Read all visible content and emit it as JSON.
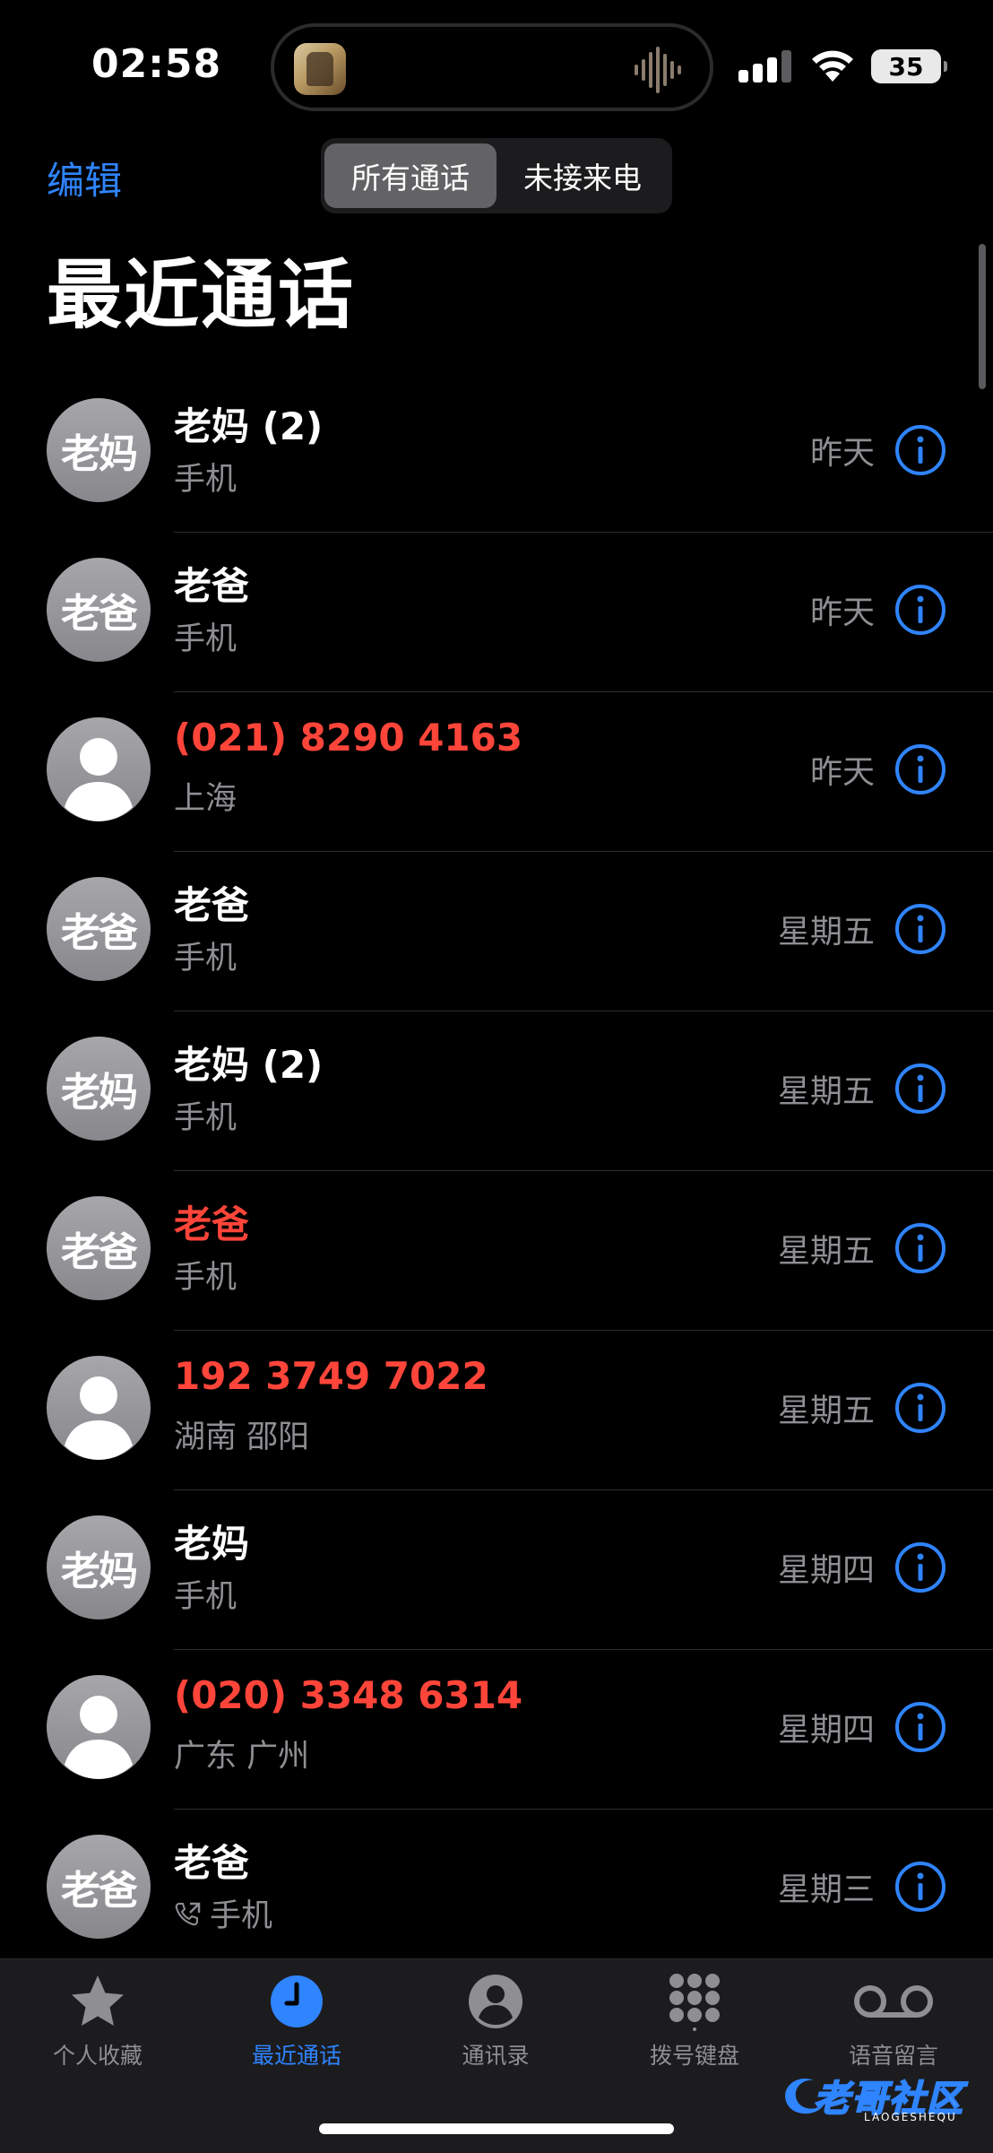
{
  "status_bar": {
    "time": "02:58",
    "battery": "35"
  },
  "nav": {
    "edit_label": "编辑",
    "segments": [
      "所有通话",
      "未接来电"
    ],
    "title": "最近通话"
  },
  "calls": [
    {
      "avatar_text": "老妈",
      "avatar_type": "initials",
      "name": "老妈 (2)",
      "missed": false,
      "subtitle": "手机",
      "outgoing": false,
      "date": "昨天"
    },
    {
      "avatar_text": "老爸",
      "avatar_type": "initials",
      "name": "老爸",
      "missed": false,
      "subtitle": "手机",
      "outgoing": false,
      "date": "昨天"
    },
    {
      "avatar_text": "",
      "avatar_type": "person",
      "name": "(021) 8290 4163",
      "missed": true,
      "subtitle": "上海",
      "outgoing": false,
      "date": "昨天"
    },
    {
      "avatar_text": "老爸",
      "avatar_type": "initials",
      "name": "老爸",
      "missed": false,
      "subtitle": "手机",
      "outgoing": false,
      "date": "星期五"
    },
    {
      "avatar_text": "老妈",
      "avatar_type": "initials",
      "name": "老妈 (2)",
      "missed": false,
      "subtitle": "手机",
      "outgoing": false,
      "date": "星期五"
    },
    {
      "avatar_text": "老爸",
      "avatar_type": "initials",
      "name": "老爸",
      "missed": true,
      "subtitle": "手机",
      "outgoing": false,
      "date": "星期五"
    },
    {
      "avatar_text": "",
      "avatar_type": "person",
      "name": "192 3749 7022",
      "missed": true,
      "subtitle": "湖南 邵阳",
      "outgoing": false,
      "date": "星期五"
    },
    {
      "avatar_text": "老妈",
      "avatar_type": "initials",
      "name": "老妈",
      "missed": false,
      "subtitle": "手机",
      "outgoing": false,
      "date": "星期四"
    },
    {
      "avatar_text": "",
      "avatar_type": "person",
      "name": "(020) 3348 6314",
      "missed": true,
      "subtitle": "广东 广州",
      "outgoing": false,
      "date": "星期四"
    },
    {
      "avatar_text": "老爸",
      "avatar_type": "initials",
      "name": "老爸",
      "missed": false,
      "subtitle": "手机",
      "outgoing": true,
      "date": "星期三"
    }
  ],
  "tabs": [
    {
      "label": "个人收藏",
      "icon": "star-icon",
      "active": false
    },
    {
      "label": "最近通话",
      "icon": "clock-icon",
      "active": true
    },
    {
      "label": "通讯录",
      "icon": "contact-icon",
      "active": false
    },
    {
      "label": "拨号键盘",
      "icon": "keypad-icon",
      "active": false
    },
    {
      "label": "语音留言",
      "icon": "voicemail-icon",
      "active": false
    }
  ],
  "watermark": {
    "text": "老哥社区",
    "subtext": "LAOGESHEQU"
  },
  "colors": {
    "accent": "#2f84ff",
    "missed": "#ff453a",
    "secondary_text": "#8e8e93",
    "background": "#000000"
  }
}
